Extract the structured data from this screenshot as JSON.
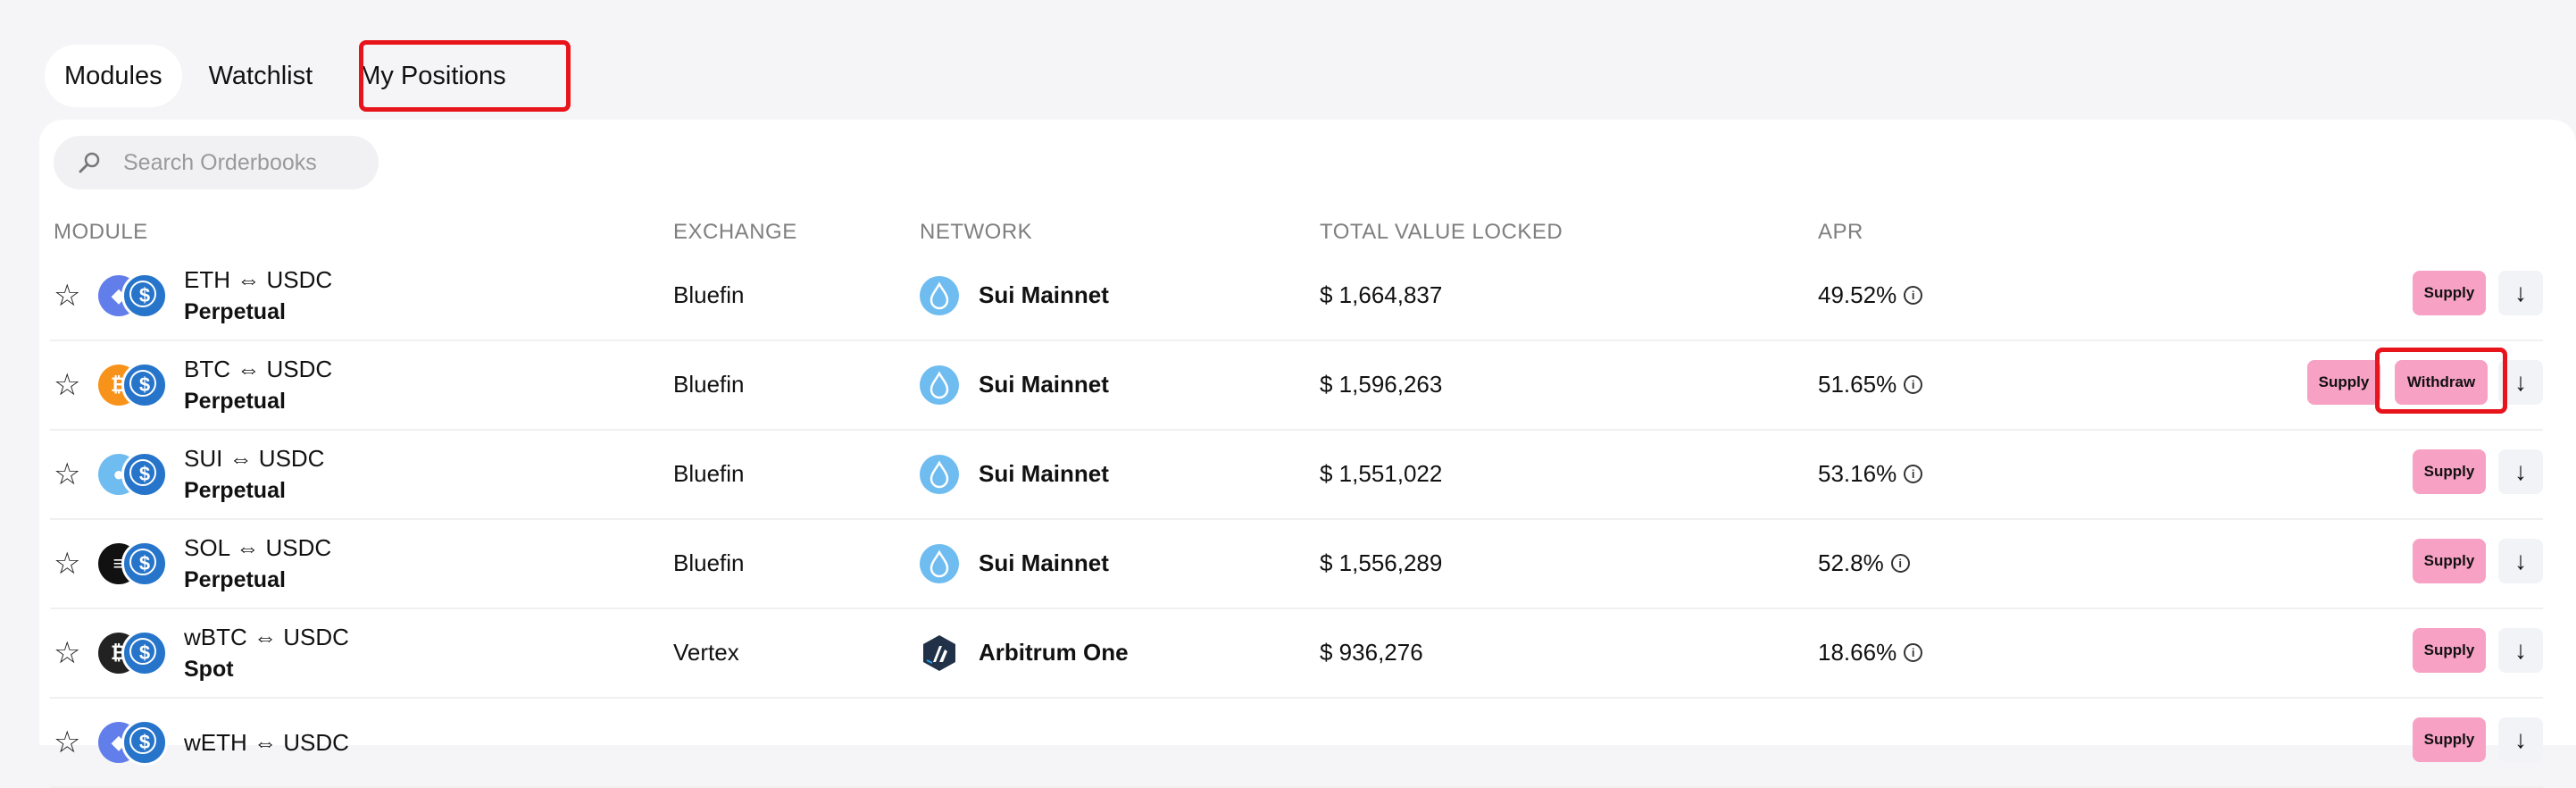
{
  "tabs": [
    {
      "label": "Modules",
      "active": true
    },
    {
      "label": "Watchlist",
      "active": false
    },
    {
      "label": "My Positions",
      "active": false,
      "highlighted": true
    }
  ],
  "search": {
    "placeholder": "Search Orderbooks"
  },
  "columns": {
    "module": "MODULE",
    "exchange": "EXCHANGE",
    "network": "NETWORK",
    "tvl": "TOTAL VALUE LOCKED",
    "apr": "APR"
  },
  "buttons": {
    "supply": "Supply",
    "withdraw": "Withdraw",
    "expand_icon": "arrow-down-icon",
    "favorite_icon": "star-outline-icon"
  },
  "colors": {
    "supply_button": "#f7a1c4",
    "highlight": "#e8141b",
    "usdc": "#2775ca"
  },
  "rows": [
    {
      "pair": "ETH ⇔ USDC",
      "type": "Perpetual",
      "base_icon": "eth-icon",
      "exchange": "Bluefin",
      "network": "Sui Mainnet",
      "network_icon": "sui-icon",
      "tvl": "$ 1,664,837",
      "apr": "49.52%",
      "show_withdraw": false
    },
    {
      "pair": "BTC ⇔ USDC",
      "type": "Perpetual",
      "base_icon": "btc-icon",
      "exchange": "Bluefin",
      "network": "Sui Mainnet",
      "network_icon": "sui-icon",
      "tvl": "$ 1,596,263",
      "apr": "51.65%",
      "show_withdraw": true
    },
    {
      "pair": "SUI ⇔ USDC",
      "type": "Perpetual",
      "base_icon": "sui-icon",
      "exchange": "Bluefin",
      "network": "Sui Mainnet",
      "network_icon": "sui-icon",
      "tvl": "$ 1,551,022",
      "apr": "53.16%",
      "show_withdraw": false
    },
    {
      "pair": "SOL ⇔ USDC",
      "type": "Perpetual",
      "base_icon": "sol-icon",
      "exchange": "Bluefin",
      "network": "Sui Mainnet",
      "network_icon": "sui-icon",
      "tvl": "$ 1,556,289",
      "apr": "52.8%",
      "show_withdraw": false
    },
    {
      "pair": "wBTC ⇔ USDC",
      "type": "Spot",
      "base_icon": "wbtc-icon",
      "exchange": "Vertex",
      "network": "Arbitrum One",
      "network_icon": "arbitrum-icon",
      "tvl": "$ 936,276",
      "apr": "18.66%",
      "show_withdraw": false
    },
    {
      "pair": "wETH ⇔ USDC",
      "type": "",
      "base_icon": "eth-icon",
      "exchange": "",
      "network": "",
      "network_icon": "",
      "tvl": "",
      "apr": "",
      "show_withdraw": false
    }
  ]
}
